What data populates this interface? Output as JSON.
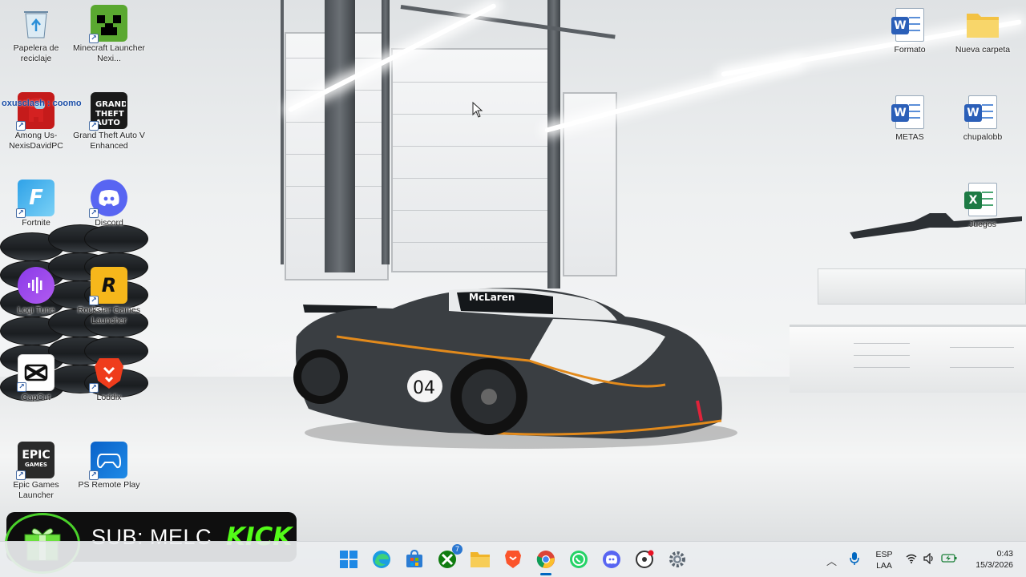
{
  "desktop_icons": {
    "recycle_bin": "Papelera de reciclaje",
    "minecraft": "Minecraft Launcher Nexi...",
    "among_us": "Among Us-NexisDavidPC",
    "gta": "Grand Theft Auto V Enhanced",
    "fortnite": "Fortnite",
    "discord": "Discord",
    "logi_tune": "Logi Tune",
    "rockstar": "Rockstar Games Launcher",
    "capcut": "CapCut",
    "loddix": "Loddix",
    "epic": "Epic Games Launcher",
    "ps_remote": "PS Remote Play",
    "formato": "Formato",
    "nueva_carpeta": "Nueva carpeta",
    "metas": "METAS",
    "chupalobb": "chupalobb",
    "juegos": "Juegos"
  },
  "chat_overlay": "oxusclash : coomo",
  "stream_overlay": {
    "sub_text": "SUB: MELC",
    "platform": "KICK"
  },
  "wallpaper": {
    "car_number": "04",
    "car_brand": "McLaren"
  },
  "taskbar": {
    "xbox_badge": "7",
    "language_primary": "ESP",
    "language_secondary": "LAA",
    "time": "0:43",
    "date": "15/3/2026"
  },
  "colors": {
    "kick_green": "#53fc18",
    "taskbar_bg": "#eceef0",
    "word_blue": "#2b5fb8",
    "excel_green": "#1d7a44"
  }
}
